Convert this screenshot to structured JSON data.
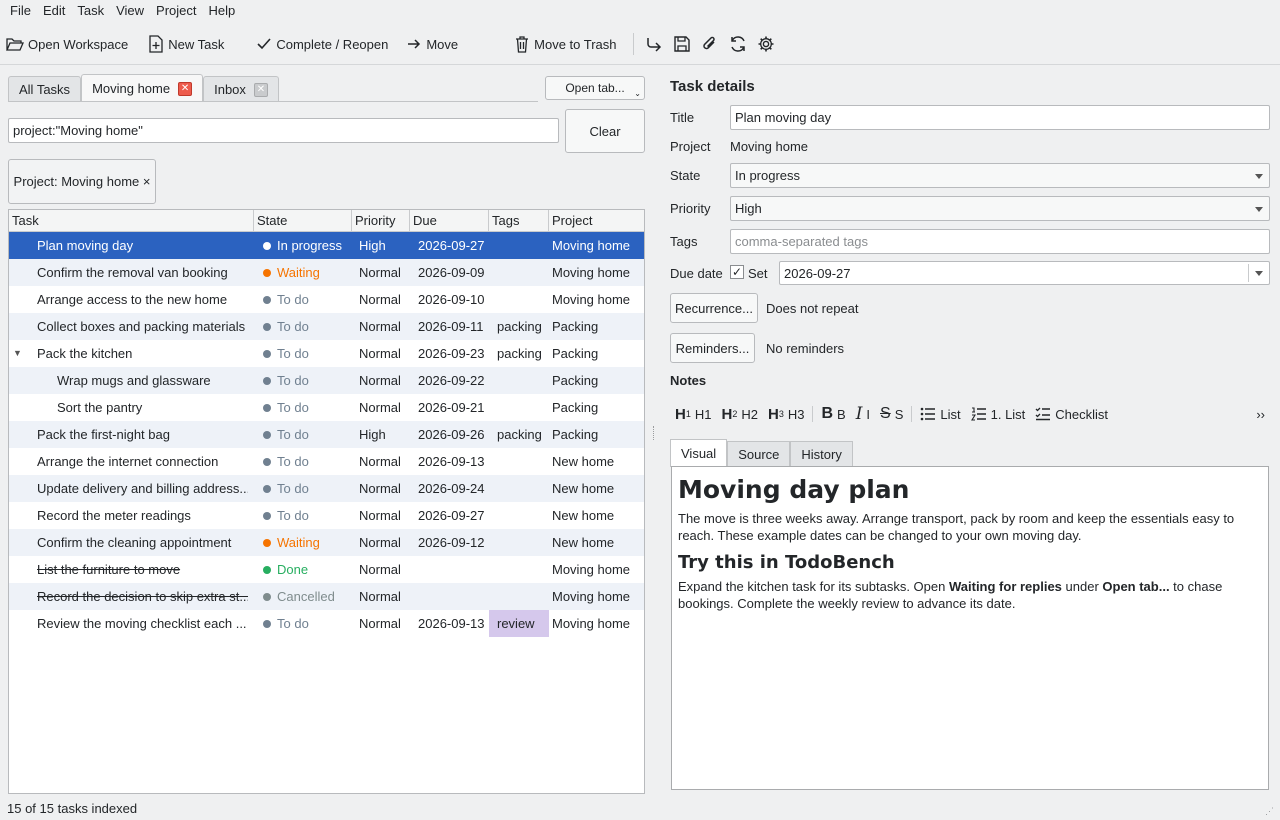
{
  "menu": [
    "File",
    "Edit",
    "Task",
    "View",
    "Project",
    "Help"
  ],
  "toolbar": {
    "open_workspace": "Open Workspace",
    "new_task": "New Task",
    "complete_reopen": "Complete / Reopen",
    "move": "Move",
    "move_to_trash": "Move to Trash",
    "icons": [
      "redo-icon",
      "save-icon",
      "attach-icon",
      "sync-icon",
      "settings-icon"
    ]
  },
  "tabs": [
    {
      "label": "All Tasks",
      "closable": false
    },
    {
      "label": "Moving home",
      "closable": true,
      "active": true
    },
    {
      "label": "Inbox",
      "closable": true
    }
  ],
  "open_tab_label": "Open tab...",
  "filter": {
    "query": "project:\"Moving home\"",
    "clear_label": "Clear"
  },
  "chip": {
    "label": "Project: Moving home ×"
  },
  "table": {
    "columns": [
      "Task",
      "State",
      "Priority",
      "Due",
      "Tags",
      "Project"
    ],
    "rows": [
      {
        "task": "Plan moving day",
        "state": "In progress",
        "priority": "High",
        "due": "2026-09-27",
        "tags": "",
        "project": "Moving home"
      },
      {
        "task": "Confirm the removal van booking",
        "state": "Waiting",
        "priority": "Normal",
        "due": "2026-09-09",
        "tags": "",
        "project": "Moving home"
      },
      {
        "task": "Arrange access to the new home",
        "state": "To do",
        "priority": "Normal",
        "due": "2026-09-10",
        "tags": "",
        "project": "Moving home"
      },
      {
        "task": "Collect boxes and packing materials",
        "state": "To do",
        "priority": "Normal",
        "due": "2026-09-11",
        "tags": "packing",
        "project": "Packing"
      },
      {
        "task": "Pack the kitchen",
        "state": "To do",
        "priority": "Normal",
        "due": "2026-09-23",
        "tags": "packing",
        "project": "Packing"
      },
      {
        "task": "Wrap mugs and glassware",
        "state": "To do",
        "priority": "Normal",
        "due": "2026-09-22",
        "tags": "",
        "project": "Packing"
      },
      {
        "task": "Sort the pantry",
        "state": "To do",
        "priority": "Normal",
        "due": "2026-09-21",
        "tags": "",
        "project": "Packing"
      },
      {
        "task": "Pack the first-night bag",
        "state": "To do",
        "priority": "High",
        "due": "2026-09-26",
        "tags": "packing",
        "project": "Packing"
      },
      {
        "task": "Arrange the internet connection",
        "state": "To do",
        "priority": "Normal",
        "due": "2026-09-13",
        "tags": "",
        "project": "New home"
      },
      {
        "task": "Update delivery and billing address...",
        "state": "To do",
        "priority": "Normal",
        "due": "2026-09-24",
        "tags": "",
        "project": "New home"
      },
      {
        "task": "Record the meter readings",
        "state": "To do",
        "priority": "Normal",
        "due": "2026-09-27",
        "tags": "",
        "project": "New home"
      },
      {
        "task": "Confirm the cleaning appointment",
        "state": "Waiting",
        "priority": "Normal",
        "due": "2026-09-12",
        "tags": "",
        "project": "New home"
      },
      {
        "task": "List the furniture to move",
        "state": "Done",
        "priority": "Normal",
        "due": "",
        "tags": "",
        "project": "Moving home"
      },
      {
        "task": "Record the decision to skip extra st...",
        "state": "Cancelled",
        "priority": "Normal",
        "due": "",
        "tags": "",
        "project": "Moving home"
      },
      {
        "task": "Review the moving checklist each ...",
        "state": "To do",
        "priority": "Normal",
        "due": "2026-09-13",
        "tags": "review",
        "project": "Moving home"
      }
    ]
  },
  "state_colors": {
    "In progress": "#ffffff",
    "Waiting": "#f67400",
    "To do": "#708090",
    "Done": "#27ae60",
    "Cancelled": "#7f8c8d"
  },
  "status_bar": "15 of 15 tasks indexed",
  "details": {
    "heading": "Task details",
    "title_label": "Title",
    "title_value": "Plan moving day",
    "project_label": "Project",
    "project_value": "Moving home",
    "state_label": "State",
    "state_value": "In progress",
    "priority_label": "Priority",
    "priority_value": "High",
    "tags_label": "Tags",
    "tags_placeholder": "comma-separated tags",
    "due_label": "Due date",
    "due_set_label": "Set",
    "due_value": "2026-09-27",
    "recurrence_button": "Recurrence...",
    "recurrence_value": "Does not repeat",
    "reminders_button": "Reminders...",
    "reminders_value": "No reminders",
    "notes_label": "Notes"
  },
  "notes_toolbar": {
    "h1": "H1",
    "h2": "H2",
    "h3": "H3",
    "bold": "B",
    "italic": "I",
    "strike": "S",
    "list": "List",
    "numbered_list": "1. List",
    "checklist": "Checklist",
    "more": "››"
  },
  "notes_tabs": [
    "Visual",
    "Source",
    "History"
  ],
  "notes": {
    "h1": "Moving day plan",
    "p1": "The move is three weeks away. Arrange transport, pack by room and keep the essentials easy to reach. These example dates can be changed to your own moving day.",
    "h2": "Try this in TodoBench",
    "p2_a": "Expand the kitchen task for its subtasks. Open ",
    "p2_b": "Waiting for replies",
    "p2_c": " under ",
    "p2_d": "Open tab...",
    "p2_e": " to chase bookings. Complete the weekly review to advance its date."
  }
}
